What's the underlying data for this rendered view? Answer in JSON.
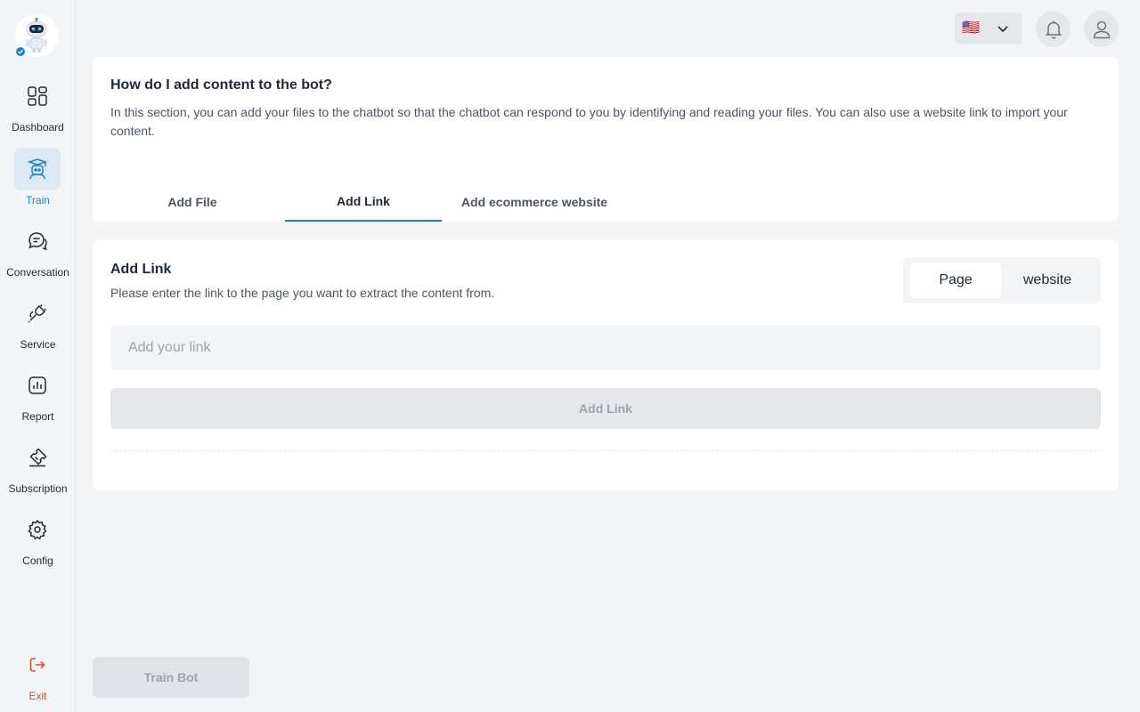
{
  "sidebar": {
    "items": [
      {
        "label": "Dashboard",
        "icon": "dashboard-icon"
      },
      {
        "label": "Train",
        "icon": "train-icon",
        "active": true
      },
      {
        "label": "Conversation",
        "icon": "conversation-icon"
      },
      {
        "label": "Service",
        "icon": "plug-icon"
      },
      {
        "label": "Report",
        "icon": "report-icon"
      },
      {
        "label": "Subscription",
        "icon": "ticket-icon"
      },
      {
        "label": "Config",
        "icon": "gear-icon"
      }
    ],
    "exit_label": "Exit"
  },
  "header": {
    "language_flag": "🇺🇸"
  },
  "info": {
    "title": "How do I add content to the bot?",
    "description": "In this section, you can add your files to the chatbot so that the chatbot can respond to you by identifying and reading your files. You can also use a website link to import your content.",
    "tabs": [
      {
        "label": "Add File"
      },
      {
        "label": "Add Link",
        "active": true
      },
      {
        "label": "Add ecommerce website"
      }
    ]
  },
  "link_panel": {
    "title": "Add Link",
    "description": "Please enter the link to the page you want to extract the content from.",
    "toggle": {
      "options": [
        "Page",
        "website"
      ],
      "selected": "Page"
    },
    "input_placeholder": "Add your link",
    "input_value": "",
    "button_label": "Add Link"
  },
  "footer": {
    "train_button_label": "Train Bot"
  },
  "colors": {
    "accent": "#1683d8",
    "exit": "#ea4b22",
    "background": "#f4f5f7"
  }
}
